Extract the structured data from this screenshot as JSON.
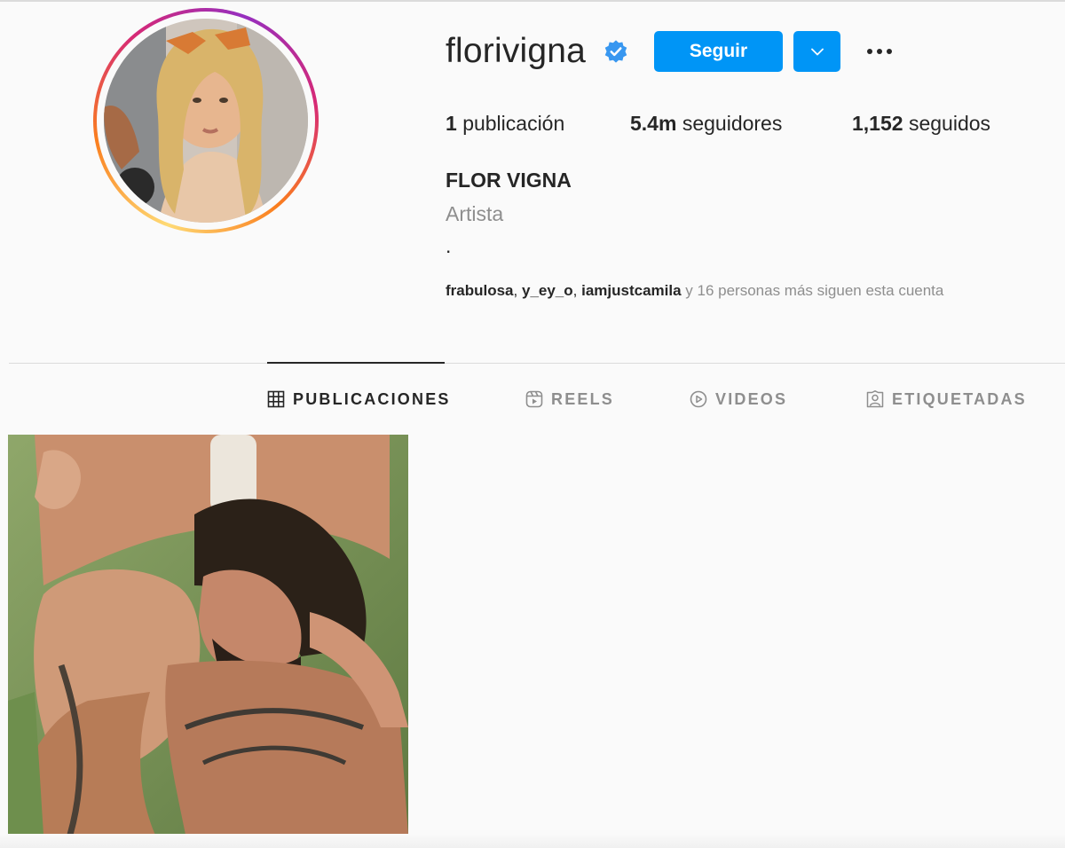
{
  "profile": {
    "username": "florivigna",
    "follow_label": "Seguir",
    "posts_count": "1",
    "posts_label": "publicación",
    "followers_count": "5.4m",
    "followers_label": "seguidores",
    "following_count": "1,152",
    "following_label": "seguidos",
    "full_name": "FLOR VIGNA",
    "category": "Artista",
    "bio": ".",
    "followed_by": {
      "accounts": [
        "frabulosa",
        "y_ey_o",
        "iamjustcamila"
      ],
      "rest": "y 16 personas más siguen esta cuenta"
    }
  },
  "tabs": [
    {
      "label": "PUBLICACIONES",
      "icon": "grid-icon",
      "active": true
    },
    {
      "label": "REELS",
      "icon": "reels-icon",
      "active": false
    },
    {
      "label": "VIDEOS",
      "icon": "play-circle-icon",
      "active": false
    },
    {
      "label": "ETIQUETADAS",
      "icon": "tagged-person-icon",
      "active": false
    }
  ],
  "colors": {
    "accent": "#0095f6",
    "verified": "#3897f0",
    "text": "#262626",
    "muted": "#8e8e8e"
  }
}
